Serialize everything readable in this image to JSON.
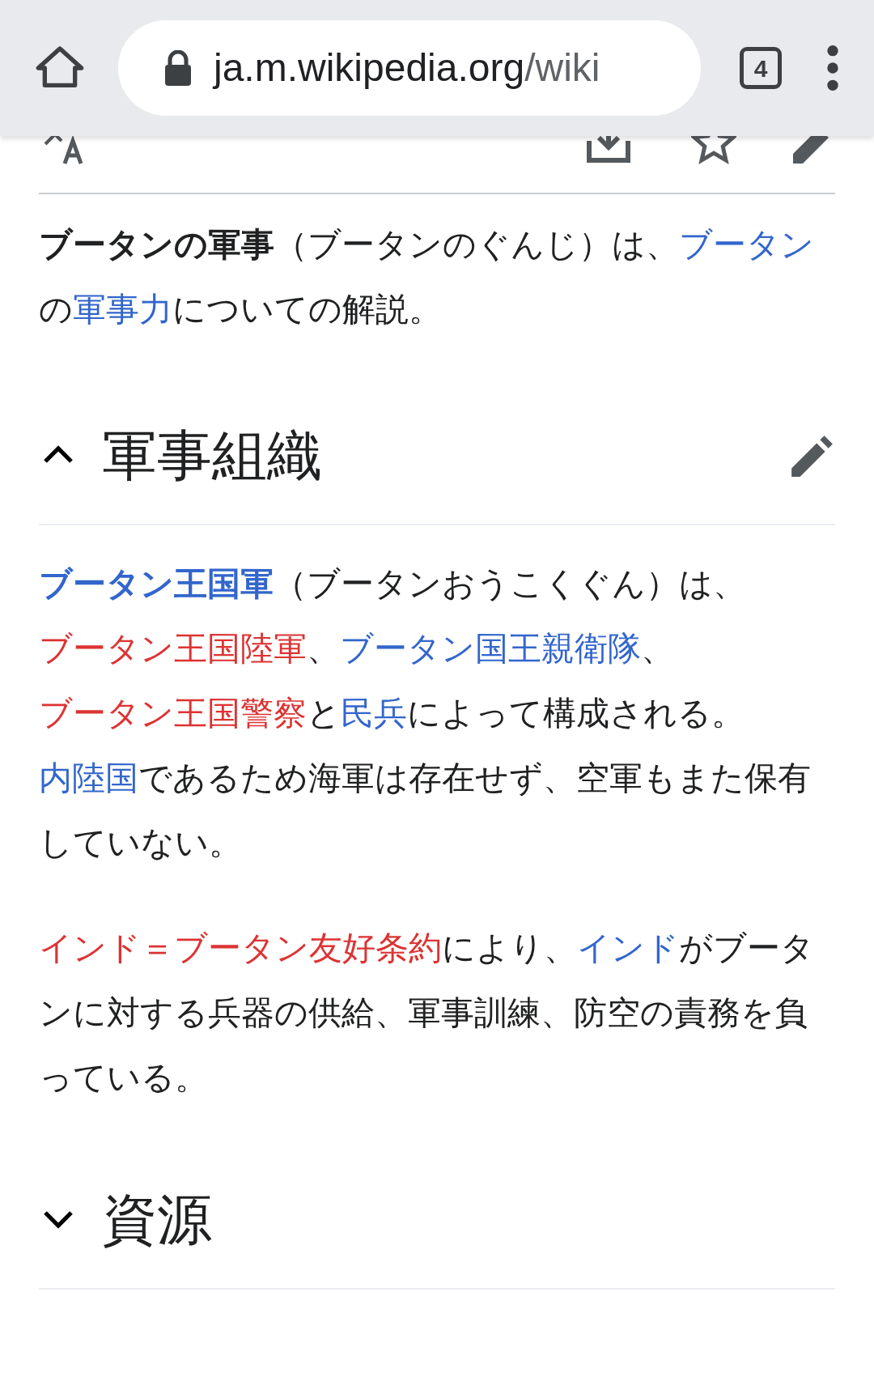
{
  "browser": {
    "url_host": "ja.m.wikipedia.org",
    "url_path": "/wiki",
    "tab_count": "4"
  },
  "intro": [
    {
      "kind": "bold",
      "text": "ブータンの軍事"
    },
    {
      "kind": "text",
      "text": "（ブータンのぐんじ）は、"
    },
    {
      "kind": "link",
      "text": "ブータン"
    },
    {
      "kind": "text",
      "text": "の"
    },
    {
      "kind": "link",
      "text": "軍事力"
    },
    {
      "kind": "text",
      "text": "についての解説。"
    }
  ],
  "sections": [
    {
      "title": "軍事組織",
      "expanded": true,
      "paragraphs": [
        [
          {
            "kind": "boldlink",
            "text": "ブータン王国軍"
          },
          {
            "kind": "text",
            "text": "（ブータンおうこくぐん）は、"
          },
          {
            "kind": "redlink",
            "text": "ブータン王国陸軍"
          },
          {
            "kind": "text",
            "text": "、"
          },
          {
            "kind": "link",
            "text": "ブータン国王親衛隊"
          },
          {
            "kind": "text",
            "text": "、"
          },
          {
            "kind": "redlink",
            "text": "ブータン王国警察"
          },
          {
            "kind": "text",
            "text": "と"
          },
          {
            "kind": "link",
            "text": "民兵"
          },
          {
            "kind": "text",
            "text": "によって構成される。"
          },
          {
            "kind": "link",
            "text": "内陸国"
          },
          {
            "kind": "text",
            "text": "であるため海軍は存在せず、空軍もまた保有していない。"
          }
        ],
        [
          {
            "kind": "redlink",
            "text": "インド＝ブータン友好条約"
          },
          {
            "kind": "text",
            "text": "により、"
          },
          {
            "kind": "link",
            "text": "インド"
          },
          {
            "kind": "text",
            "text": "がブータンに対する兵器の供給、軍事訓練、防空の責務を負っている。"
          }
        ]
      ]
    },
    {
      "title": "資源",
      "expanded": false
    }
  ]
}
